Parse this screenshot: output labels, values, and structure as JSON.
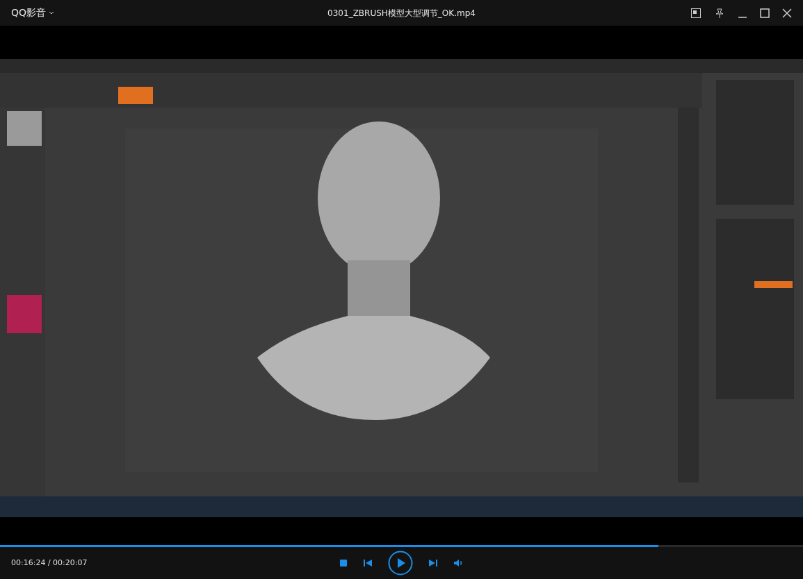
{
  "app": {
    "name": "QQ影音",
    "title": "0301_ZBRUSH模型大型调节_OK.mp4"
  },
  "playback": {
    "level": 0.82,
    "time": "00:16:24 / 00:20:07",
    "playing": false
  }
}
